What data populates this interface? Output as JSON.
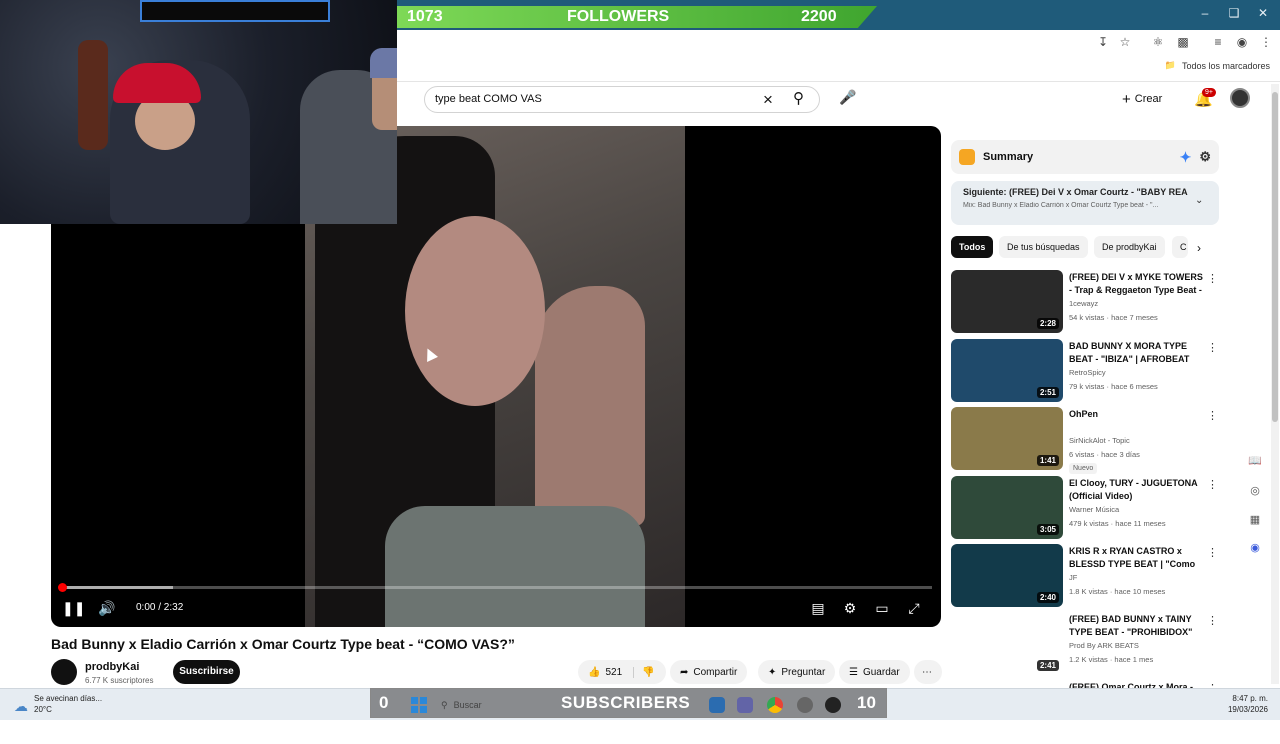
{
  "overlay": {
    "followers_current": "1073",
    "followers_label": "FOLLOWERS",
    "followers_goal": "2200",
    "subs_current": "0",
    "subs_label": "SUBSCRIBERS",
    "subs_goal": "10"
  },
  "browser": {
    "bookmarks_label": "Todos los marcadores"
  },
  "header": {
    "search_value": "type beat COMO VAS",
    "create_label": "Crear",
    "notif_badge": "9+"
  },
  "player": {
    "time": "0:00 / 2:32",
    "progress_fraction": 0.0,
    "buffered_fraction": 0.13
  },
  "video": {
    "title": "Bad Bunny x Eladio Carrión x Omar Courtz Type beat - “COMO VAS?”",
    "channel": "prodbyKai",
    "subscribers": "6.77 K suscriptores",
    "subscribe_label": "Suscribirse",
    "likes": "521",
    "share_label": "Compartir",
    "ask_label": "Preguntar",
    "save_label": "Guardar"
  },
  "sidebar": {
    "summary_label": "Summary",
    "next_title": "Siguiente: (FREE) Dei V x Omar Courtz - \"BABY REA...",
    "next_sub": "Mix: Bad Bunny x Eladio Carrión x Omar Courtz Type beat - \"...",
    "chips": [
      "Todos",
      "De tus búsquedas",
      "De prodbyKai",
      "C"
    ],
    "recs": [
      {
        "title": "(FREE) DEI V x MYKE TOWERS - Trap & Reggaeton Type Beat - ...",
        "channel": "1cewayz",
        "meta": "54 k vistas · hace 7 meses",
        "duration": "2:28",
        "thumb_color": "#2a2a2a"
      },
      {
        "title": "BAD BUNNY X MORA TYPE BEAT - \"IBIZA\" | AFROBEAT",
        "channel": "RetroSpicy",
        "meta": "79 k vistas · hace 6 meses",
        "duration": "2:51",
        "thumb_color": "#1f4a6b"
      },
      {
        "title": "OhPen",
        "channel": "SirNickAlot - Topic",
        "meta": "6 vistas · hace 3 días",
        "duration": "1:41",
        "thumb_color": "#8a7a4a",
        "badge": "Nuevo"
      },
      {
        "title": "El Clooy, TURY - JUGUETONA (Official Video)",
        "channel": "Warner Música",
        "meta": "479 k vistas · hace 11 meses",
        "duration": "3:05",
        "thumb_color": "#2f4a3a"
      },
      {
        "title": "KRIS R x RYAN CASTRO x BLESSD TYPE BEAT | \"Como t...",
        "channel": "JF",
        "meta": "1.8 K vistas · hace 10 meses",
        "duration": "2:40",
        "thumb_color": "#123a4a"
      },
      {
        "title": "(FREE) BAD BUNNY x TAINY TYPE BEAT - \"PROHIBIDOX\"",
        "channel": "Prod By ARK BEATS",
        "meta": "1.2 K vistas · hace 1 mes",
        "duration": "2:41",
        "thumb_color": "#ffffff"
      },
      {
        "title": "(FREE) Omar Courtz x Mora - ...",
        "channel": "",
        "meta": "",
        "duration": "",
        "thumb_color": "#ffffff"
      }
    ]
  },
  "taskbar": {
    "weather_line1": "Se avecinan días...",
    "weather_line2": "20°C",
    "search_placeholder": "Buscar",
    "clock_time": "8:47 p. m.",
    "clock_date": "19/03/2026"
  }
}
